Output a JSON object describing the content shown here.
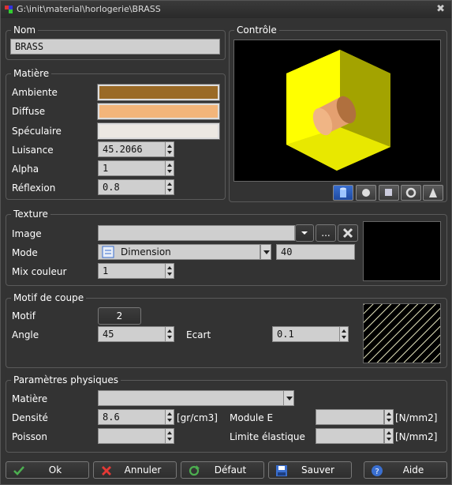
{
  "window": {
    "title": "G:\\init\\material\\horlogerie\\BRASS"
  },
  "nom": {
    "group_label": "Nom",
    "value": "BRASS"
  },
  "controle": {
    "group_label": "Contrôle"
  },
  "matiere": {
    "group_label": "Matière",
    "ambiente_label": "Ambiente",
    "diffuse_label": "Diffuse",
    "speculaire_label": "Spéculaire",
    "luisance_label": "Luisance",
    "luisance_value": "45.2066",
    "alpha_label": "Alpha",
    "alpha_value": "1",
    "reflexion_label": "Réflexion",
    "reflexion_value": "0.8",
    "colors": {
      "ambiente": "#9a6a26",
      "diffuse": "#f3b57a",
      "speculaire": "#ece8e2"
    }
  },
  "texture": {
    "group_label": "Texture",
    "image_label": "Image",
    "image_value": "",
    "browse_label": "...",
    "mode_label": "Mode",
    "mode_value": "Dimension",
    "mode_number": "40",
    "mix_label": "Mix couleur",
    "mix_value": "1"
  },
  "motif": {
    "group_label": "Motif de coupe",
    "motif_label": "Motif",
    "motif_value": "2",
    "angle_label": "Angle",
    "angle_value": "45",
    "ecart_label": "Ecart",
    "ecart_value": "0.1"
  },
  "physique": {
    "group_label": "Paramètres physiques",
    "matiere_label": "Matière",
    "matiere_value": "",
    "densite_label": "Densité",
    "densite_value": "8.6",
    "densite_unit": "[gr/cm3]",
    "module_label": "Module E",
    "module_value": "",
    "module_unit": "[N/mm2]",
    "poisson_label": "Poisson",
    "poisson_value": "",
    "limite_label": "Limite élastique",
    "limite_value": "",
    "limite_unit": "[N/mm2]"
  },
  "buttons": {
    "ok": "Ok",
    "annuler": "Annuler",
    "defaut": "Défaut",
    "sauver": "Sauver",
    "aide": "Aide"
  }
}
